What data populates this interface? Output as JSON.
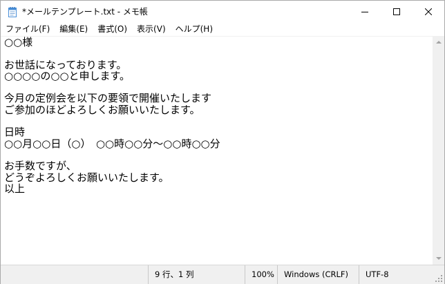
{
  "window": {
    "title": "*メールテンプレート.txt - メモ帳"
  },
  "menu": [
    {
      "label": "ファイル(F)",
      "name": "menu-file"
    },
    {
      "label": "編集(E)",
      "name": "menu-edit"
    },
    {
      "label": "書式(O)",
      "name": "menu-format"
    },
    {
      "label": "表示(V)",
      "name": "menu-view"
    },
    {
      "label": "ヘルプ(H)",
      "name": "menu-help"
    }
  ],
  "editor": {
    "lines": [
      "○○様",
      "",
      "お世話になっております。",
      "○○○○の○○と申します。",
      "",
      "今月の定例会を以下の要領で開催いたします",
      "ご参加のほどよろしくお願いいたします。",
      "",
      "日時",
      "○○月○○日（○）　○○時○○分～○○時○○分",
      "",
      "お手数ですが、",
      "どうぞよろしくお願いいたします。",
      "以上"
    ]
  },
  "status": {
    "position": "9 行、1 列",
    "zoom": "100%",
    "line_ending": "Windows (CRLF)",
    "encoding": "UTF-8"
  },
  "colors": {
    "chrome": "#f0f0f0",
    "text": "#000000",
    "icon_blue": "#4a8fd8"
  },
  "icons": {
    "app": "notepad-icon",
    "minimize": "minimize-icon",
    "maximize": "maximize-icon",
    "close": "close-icon"
  }
}
